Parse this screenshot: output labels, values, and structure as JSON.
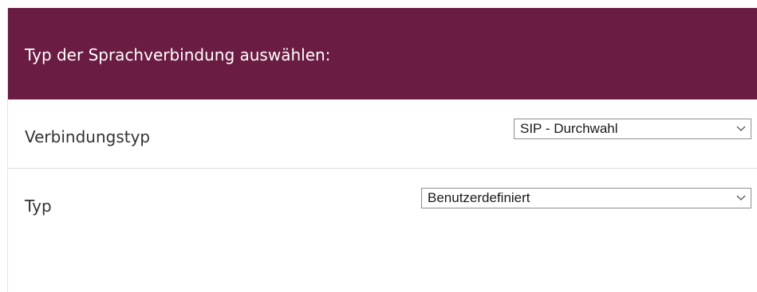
{
  "header": {
    "title": "Typ der Sprachverbindung auswählen:"
  },
  "fields": [
    {
      "label": "Verbindungstyp",
      "value": "SIP - Durchwahl"
    },
    {
      "label": "Typ",
      "value": "Benutzerdefiniert"
    }
  ],
  "colors": {
    "header_background": "#6b1c42",
    "header_text": "#ffffff"
  },
  "icons": {
    "dropdown": "chevron-down-icon"
  }
}
